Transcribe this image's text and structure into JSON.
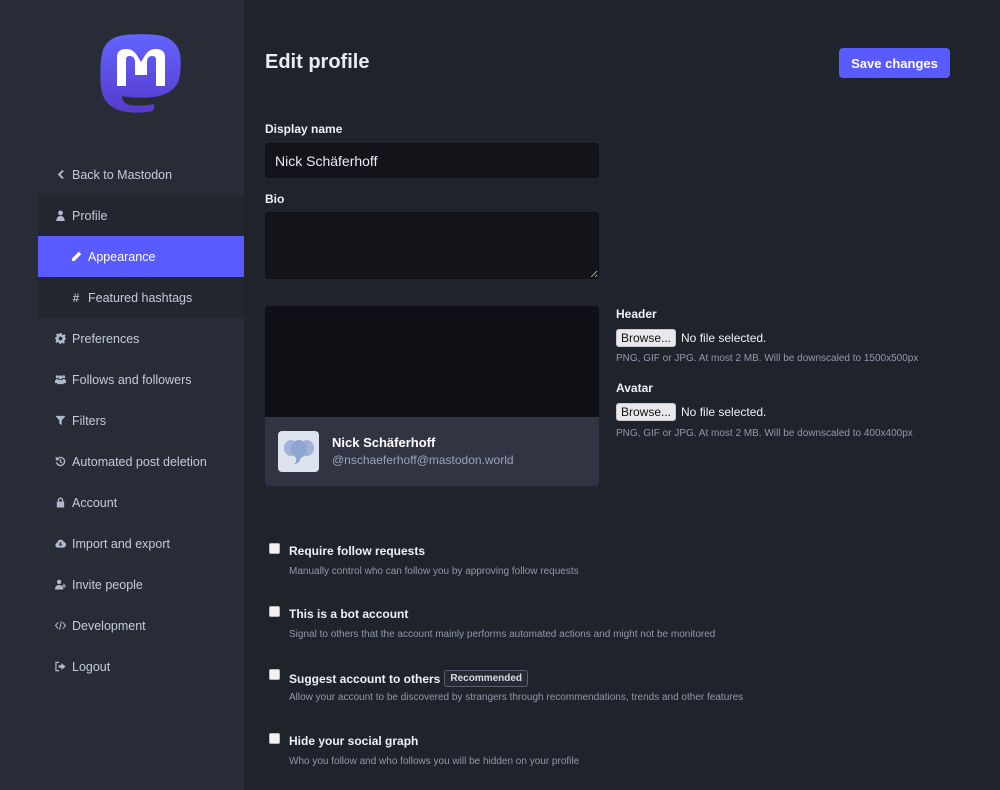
{
  "sidebar": {
    "logo": "mastodon-logo",
    "items": [
      {
        "label": "Back to Mastodon",
        "icon": "chevron-left-icon"
      },
      {
        "label": "Profile",
        "icon": "user-icon"
      },
      {
        "label": "Appearance",
        "icon": "pencil-icon",
        "active": true
      },
      {
        "label": "Featured hashtags",
        "icon": "hashtag-icon"
      },
      {
        "label": "Preferences",
        "icon": "gear-icon"
      },
      {
        "label": "Follows and followers",
        "icon": "users-icon"
      },
      {
        "label": "Filters",
        "icon": "filter-icon"
      },
      {
        "label": "Automated post deletion",
        "icon": "history-icon"
      },
      {
        "label": "Account",
        "icon": "lock-icon"
      },
      {
        "label": "Import and export",
        "icon": "cloud-download-icon"
      },
      {
        "label": "Invite people",
        "icon": "user-plus-icon"
      },
      {
        "label": "Development",
        "icon": "code-icon"
      },
      {
        "label": "Logout",
        "icon": "sign-out-icon"
      }
    ]
  },
  "main": {
    "title": "Edit profile",
    "save_label": "Save changes",
    "display_name": {
      "label": "Display name",
      "value": "Nick Schäferhoff"
    },
    "bio": {
      "label": "Bio",
      "value": ""
    },
    "preview": {
      "name": "Nick Schäferhoff",
      "handle": "@nschaeferhoff@mastodon.world"
    },
    "header_upload": {
      "label": "Header",
      "browse": "Browse...",
      "status": "No file selected.",
      "hint": "PNG, GIF or JPG. At most 2 MB. Will be downscaled to 1500x500px"
    },
    "avatar_upload": {
      "label": "Avatar",
      "browse": "Browse...",
      "status": "No file selected.",
      "hint": "PNG, GIF or JPG. At most 2 MB. Will be downscaled to 400x400px"
    },
    "options": [
      {
        "label": "Require follow requests",
        "hint": "Manually control who can follow you by approving follow requests",
        "checked": false
      },
      {
        "label": "This is a bot account",
        "hint": "Signal to others that the account mainly performs automated actions and might not be monitored",
        "checked": false
      },
      {
        "label": "Suggest account to others",
        "badge": "Recommended",
        "hint": "Allow your account to be discovered by strangers through recommendations, trends and other features",
        "checked": false
      },
      {
        "label": "Hide your social graph",
        "hint": "Who you follow and who follows you will be hidden on your profile",
        "checked": false
      }
    ]
  },
  "colors": {
    "accent": "#595aff",
    "sidebar_bg": "#282c37",
    "main_bg": "#1f232b"
  }
}
